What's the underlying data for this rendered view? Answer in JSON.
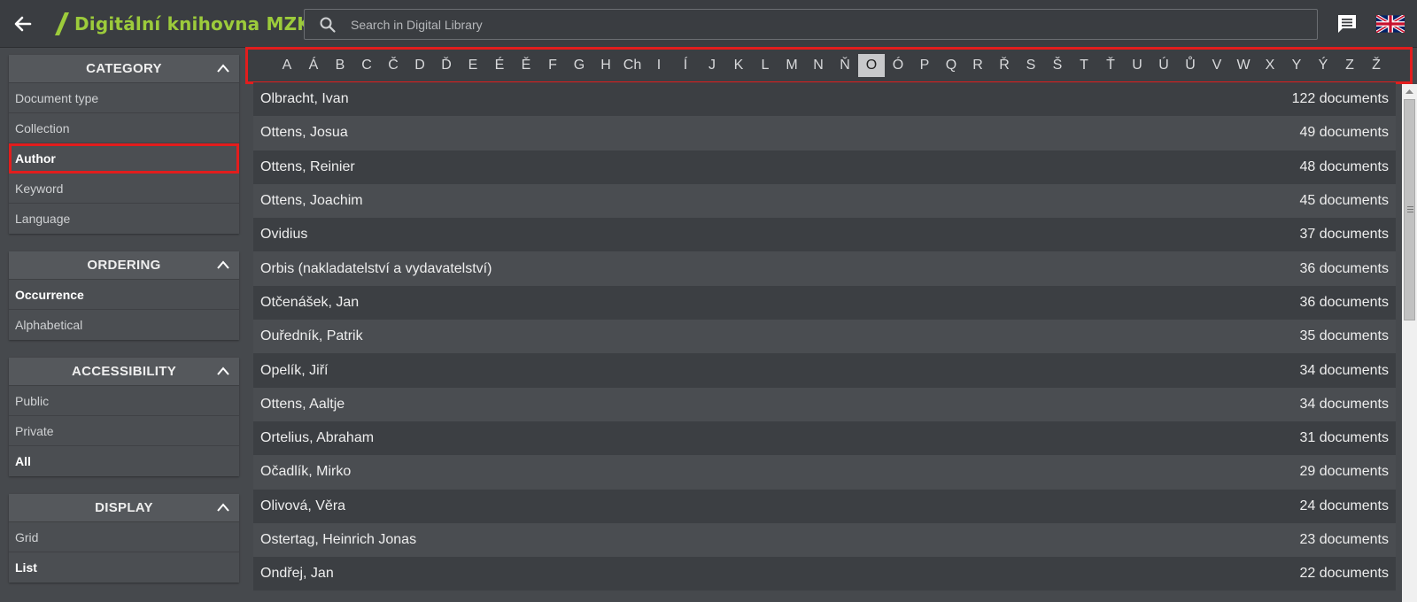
{
  "header": {
    "back_icon": "arrow-left-icon",
    "logo_text": "Digitální knihovna MZK",
    "logo_color": "#9ccb3b",
    "search_placeholder": "Search in Digital Library",
    "search_icon": "search-icon",
    "chat_icon": "chat-bubble-icon",
    "language_flag": "uk-flag-icon"
  },
  "sidebar": {
    "category": {
      "title": "CATEGORY",
      "items": [
        "Document type",
        "Collection",
        "Author",
        "Keyword",
        "Language"
      ],
      "active": "Author"
    },
    "ordering": {
      "title": "ORDERING",
      "items": [
        "Occurrence",
        "Alphabetical"
      ],
      "active": "Occurrence"
    },
    "accessibility": {
      "title": "ACCESSIBILITY",
      "items": [
        "Public",
        "Private",
        "All"
      ],
      "active": "All"
    },
    "display": {
      "title": "DISPLAY",
      "items": [
        "Grid",
        "List"
      ],
      "active": "List"
    }
  },
  "alphabet": {
    "letters": [
      "A",
      "Á",
      "B",
      "C",
      "Č",
      "D",
      "Ď",
      "E",
      "É",
      "Ě",
      "F",
      "G",
      "H",
      "Ch",
      "I",
      "Í",
      "J",
      "K",
      "L",
      "M",
      "N",
      "Ň",
      "O",
      "Ó",
      "P",
      "Q",
      "R",
      "Ř",
      "S",
      "Š",
      "T",
      "Ť",
      "U",
      "Ú",
      "Ů",
      "V",
      "W",
      "X",
      "Y",
      "Ý",
      "Z",
      "Ž"
    ],
    "selected": "O"
  },
  "authors": [
    {
      "name": "Olbracht, Ivan",
      "count": "122 documents"
    },
    {
      "name": "Ottens, Josua",
      "count": "49 documents"
    },
    {
      "name": "Ottens, Reinier",
      "count": "48 documents"
    },
    {
      "name": "Ottens, Joachim",
      "count": "45 documents"
    },
    {
      "name": "Ovidius",
      "count": "37 documents"
    },
    {
      "name": "Orbis (nakladatelství a vydavatelství)",
      "count": "36 documents"
    },
    {
      "name": "Otčenášek, Jan",
      "count": "36 documents"
    },
    {
      "name": "Ouředník, Patrik",
      "count": "35 documents"
    },
    {
      "name": "Opelík, Jiří",
      "count": "34 documents"
    },
    {
      "name": "Ottens, Aaltje",
      "count": "34 documents"
    },
    {
      "name": "Ortelius, Abraham",
      "count": "31 documents"
    },
    {
      "name": "Očadlík, Mirko",
      "count": "29 documents"
    },
    {
      "name": "Olivová, Věra",
      "count": "24 documents"
    },
    {
      "name": "Ostertag, Heinrich Jonas",
      "count": "23 documents"
    },
    {
      "name": "Ondřej, Jan",
      "count": "22 documents"
    }
  ],
  "colors": {
    "highlight": "#e21d1d",
    "background": "#46494d",
    "topbar": "#3a3d41"
  }
}
